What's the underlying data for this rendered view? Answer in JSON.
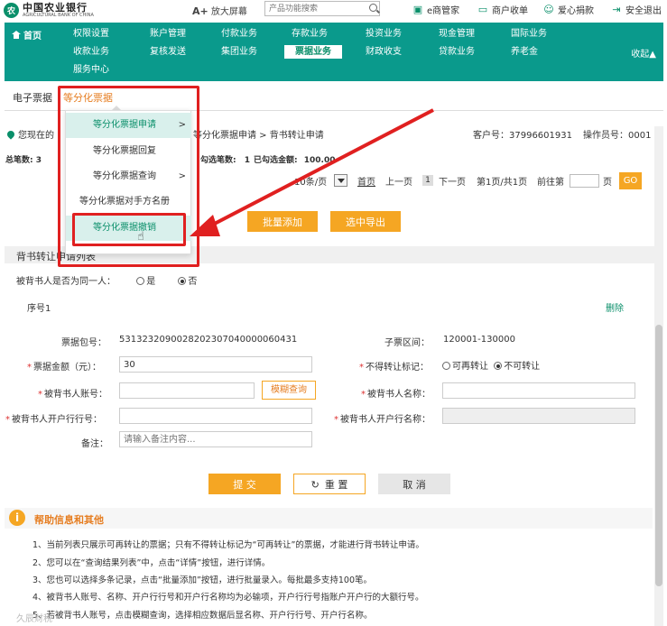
{
  "header": {
    "logo_cn": "中国农业银行",
    "logo_en": "AGRICULTURAL BANK OF CHINA",
    "zoom_prefix": "A+",
    "zoom_label": "放大屏幕",
    "search_placeholder": "产品功能搜索",
    "links": [
      "e商管家",
      "商户收单",
      "爱心捐款",
      "安全退出"
    ]
  },
  "nav": {
    "home": "首页",
    "items_row1": [
      "权限设置",
      "账户管理",
      "付款业务",
      "存款业务",
      "投资业务",
      "现金管理",
      "国际业务"
    ],
    "items_row2": [
      "收款业务",
      "复核发送",
      "集团业务",
      "票据业务",
      "财政收支",
      "贷款业务",
      "养老金"
    ],
    "items_row3": [
      "服务中心"
    ],
    "active": "票据业务",
    "collapse": "收起▲"
  },
  "tabs": {
    "first": "电子票据",
    "current": "等分化票据"
  },
  "location": {
    "prefix": "您现在的",
    "path": "等分化票据申请 > 背书转让申请",
    "customer": "客户号：37996601931",
    "operator": "操作员号：0001"
  },
  "stats": {
    "total_label": "总笔数:",
    "total_value": "3",
    "checked_label": "勾选笔数:",
    "checked_value": "1",
    "amount_label": "已勾选金额:",
    "amount_value": "100.00"
  },
  "pager": {
    "per_page": "10条/页",
    "first": "首页",
    "prev": "上一页",
    "current": "1",
    "next": "下一页",
    "info": "第1页/共1页",
    "goto": "前往第",
    "page_unit": "页",
    "go": "GO"
  },
  "actions": {
    "batch_add": "批量添加",
    "export_selected": "选中导出"
  },
  "section": {
    "title": "背书转让申请列表",
    "same_person_label": "被背书人是否为同一人：",
    "yes": "是",
    "no": "否",
    "seq": "序号1",
    "delete": "删除"
  },
  "form": {
    "bill_pkg_label": "票据包号：",
    "bill_pkg_value": "5313232090028202307040000060431",
    "sub_range_label": "子票区间：",
    "sub_range_value": "120001-130000",
    "amount_label": "票据金额（元）：",
    "amount_value": "30",
    "no_transfer_label": "不得转让标记：",
    "can_transfer": "可再转让",
    "cannot_transfer": "不可转让",
    "endorsee_account_label": "被背书人账号：",
    "fuzzy_search": "模糊查询",
    "endorsee_name_label": "被背书人名称：",
    "endorsee_bank_no_label": "被背书人开户行行号：",
    "endorsee_bank_name_label": "被背书人开户行名称：",
    "remark_label": "备注：",
    "remark_placeholder": "请输入备注内容..."
  },
  "buttons": {
    "submit": "提 交",
    "reset": "重 置",
    "cancel": "取 消"
  },
  "help": {
    "title": "帮助信息和其他",
    "lines": [
      "1、当前列表只展示可再转让的票据；只有不得转让标记为“可再转让”的票据，才能进行背书转让申请。",
      "2、您可以在“查询结果列表”中，点击“详情”按钮，进行详情。",
      "3、您也可以选择多条记录，点击“批量添加”按钮，进行批量录入。每批最多支持100笔。",
      "4、被背书人账号、名称、开户行行号和开户行名称均为必输项，开户行行号指账户开户行的大额行号。",
      "5、若被背书人账号，点击模糊查询，选择相应数据后显名称、开户行行号、开户行名称。"
    ]
  },
  "menu": {
    "items": [
      "等分化票据申请",
      "等分化票据回复",
      "等分化票据查询",
      "等分化票据对手方名册",
      "等分化票据撤销"
    ]
  },
  "watermark": "久辰财税"
}
